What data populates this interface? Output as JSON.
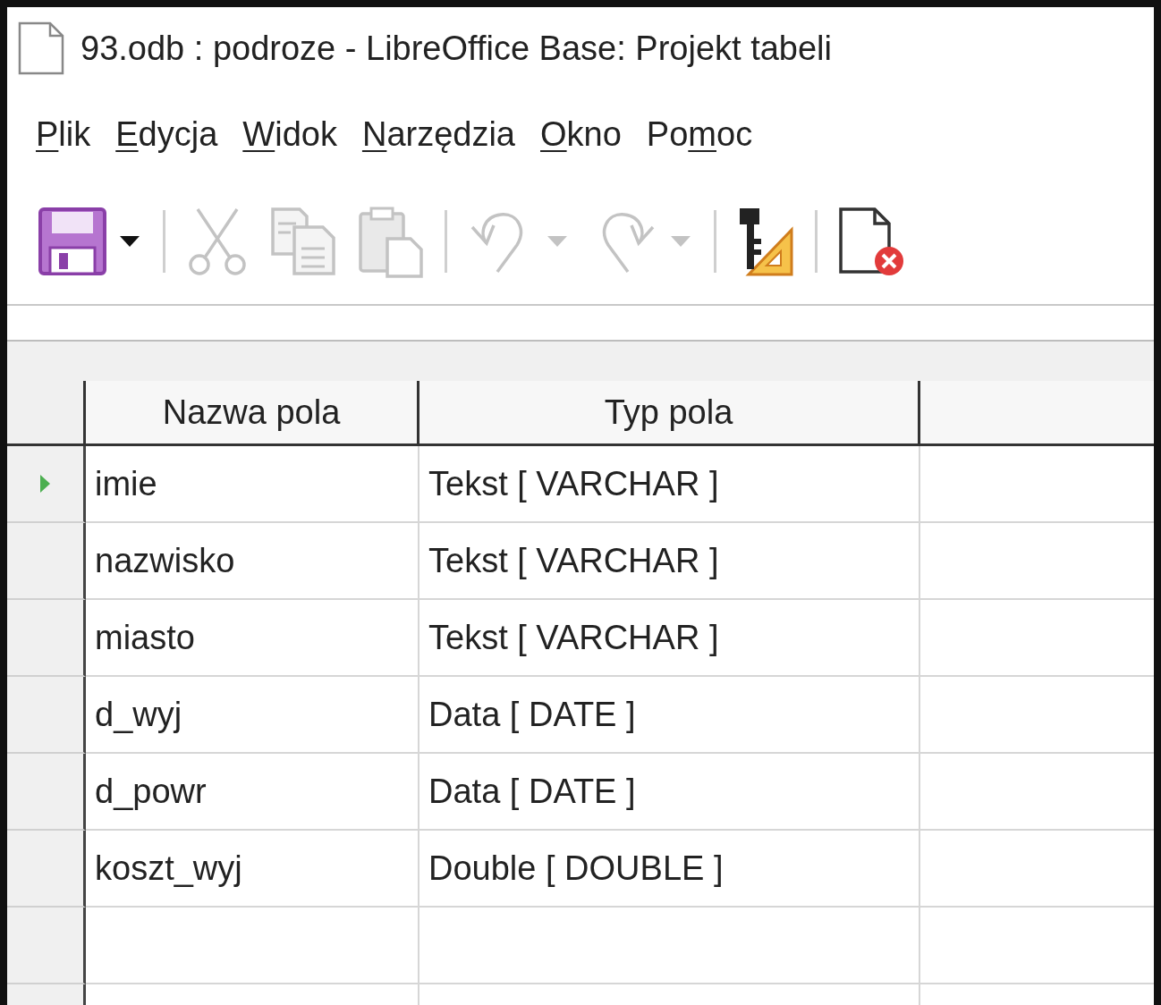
{
  "window": {
    "title": "93.odb : podroze - LibreOffice Base: Projekt tabeli"
  },
  "menu": [
    {
      "access_key": "P",
      "rest": "lik"
    },
    {
      "access_key": "E",
      "rest": "dycja"
    },
    {
      "access_key": "W",
      "rest": "idok"
    },
    {
      "access_key": "N",
      "rest": "arzędzia"
    },
    {
      "access_key": "O",
      "rest": "kno"
    },
    {
      "before_key": "Po",
      "access_key": "m",
      "rest": "oc"
    }
  ],
  "toolbar": [
    {
      "kind": "save",
      "disabled": false,
      "dropdown": true
    },
    {
      "kind": "separator"
    },
    {
      "kind": "cut",
      "disabled": true,
      "dropdown": false
    },
    {
      "kind": "copy",
      "disabled": true,
      "dropdown": false
    },
    {
      "kind": "paste",
      "disabled": true,
      "dropdown": false
    },
    {
      "kind": "separator"
    },
    {
      "kind": "undo",
      "disabled": true,
      "dropdown": true
    },
    {
      "kind": "redo",
      "disabled": true,
      "dropdown": true
    },
    {
      "kind": "separator"
    },
    {
      "kind": "primary-key",
      "disabled": false,
      "dropdown": false
    },
    {
      "kind": "separator"
    },
    {
      "kind": "close-document",
      "disabled": false,
      "dropdown": false
    }
  ],
  "table": {
    "columns": [
      "Nazwa pola",
      "Typ pola"
    ],
    "rows": [
      {
        "field_name": "imie",
        "field_type": "Tekst [ VARCHAR ]",
        "selected": true
      },
      {
        "field_name": "nazwisko",
        "field_type": "Tekst [ VARCHAR ]",
        "selected": false
      },
      {
        "field_name": "miasto",
        "field_type": "Tekst [ VARCHAR ]",
        "selected": false
      },
      {
        "field_name": "d_wyj",
        "field_type": "Data [ DATE ]",
        "selected": false
      },
      {
        "field_name": "d_powr",
        "field_type": "Data [ DATE ]",
        "selected": false
      },
      {
        "field_name": "koszt_wyj",
        "field_type": "Double [ DOUBLE ]",
        "selected": false
      }
    ]
  }
}
